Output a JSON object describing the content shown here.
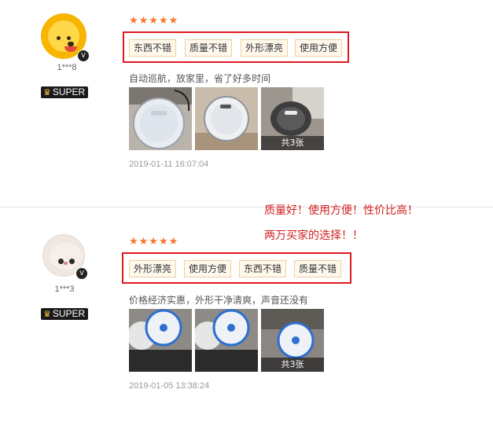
{
  "reviews": [
    {
      "user": "1***8",
      "badge": "SUPER",
      "stars": "★★★★★",
      "tags": [
        "东西不错",
        "质量不错",
        "外形漂亮",
        "使用方便"
      ],
      "comment": "自动巡航，放家里，省了好多时间",
      "photo_count": "共3张",
      "date": "2019-01-11 16:07:04"
    },
    {
      "user": "1***3",
      "badge": "SUPER",
      "stars": "★★★★★",
      "tags": [
        "外形漂亮",
        "使用方便",
        "东西不错",
        "质量不错"
      ],
      "comment": "价格经济实惠，外形干净清爽，声音还没有",
      "photo_count": "共3张",
      "date": "2019-01-05 13:38:24"
    }
  ],
  "annotations": {
    "line1": "质量好！使用方便！性价比高！",
    "line2": "两万买家的选择！！"
  },
  "colors": {
    "stars": "#f6762c",
    "highlight_box": "#e0191f",
    "annotation": "#d31f1f"
  },
  "icons": {
    "badge_icon": "crown-icon",
    "verify_icon": "v-badge-icon"
  }
}
